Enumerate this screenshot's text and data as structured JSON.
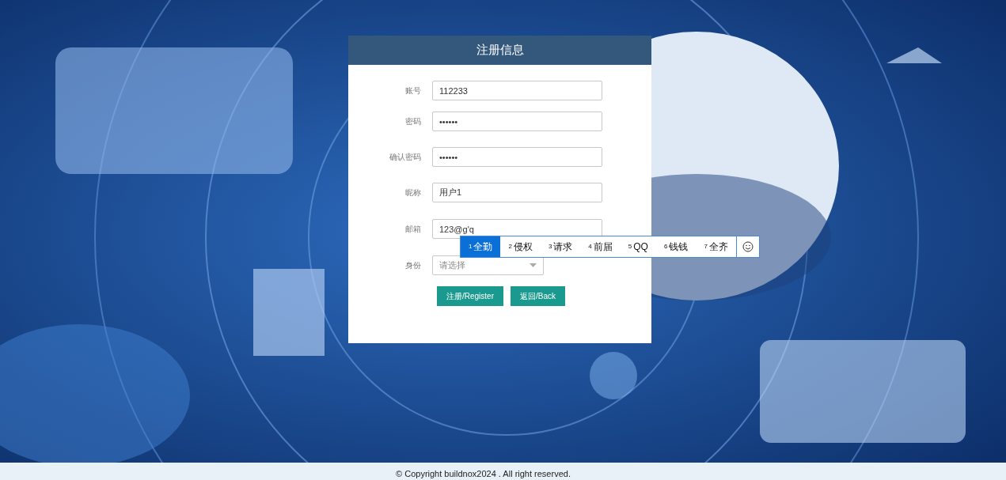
{
  "form": {
    "title": "注册信息",
    "fields": [
      {
        "kind": "text",
        "label": "账号",
        "value": "112233"
      },
      {
        "kind": "password",
        "label": "密码",
        "value": "••••••"
      },
      {
        "kind": "password",
        "label": "确认密码",
        "value": "••••••"
      },
      {
        "kind": "text",
        "label": "昵称",
        "value": "用户1"
      },
      {
        "kind": "text",
        "label": "邮箱",
        "value": "123@g'q"
      },
      {
        "kind": "select",
        "label": "身份",
        "placeholder": "请选择"
      }
    ],
    "buttons": [
      "注册/Register",
      "返回/Back"
    ]
  },
  "ime": {
    "candidates": [
      {
        "number": "1",
        "text": "全勤",
        "selected": true
      },
      {
        "number": "2",
        "text": "侵权",
        "selected": false
      },
      {
        "number": "3",
        "text": "请求",
        "selected": false
      },
      {
        "number": "4",
        "text": "前届",
        "selected": false
      },
      {
        "number": "5",
        "text": "QQ",
        "selected": false
      },
      {
        "number": "6",
        "text": "钱钱",
        "selected": false
      },
      {
        "number": "7",
        "text": "全齐",
        "selected": false
      }
    ]
  },
  "footer": "© Copyright buildnox2024 . All right reserved."
}
